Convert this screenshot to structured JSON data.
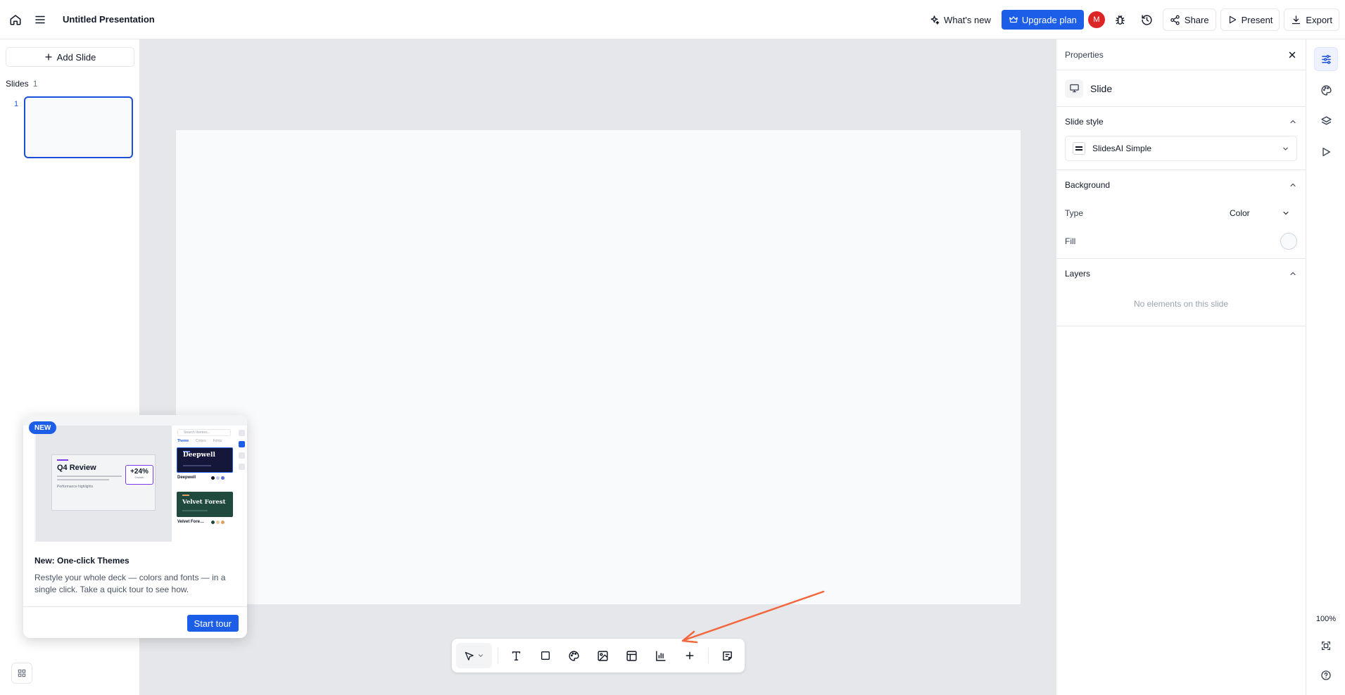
{
  "topbar": {
    "title": "Untitled Presentation",
    "whats_new": "What's new",
    "upgrade": "Upgrade plan",
    "avatar_initial": "M",
    "share": "Share",
    "present": "Present",
    "export": "Export"
  },
  "sidebar": {
    "add_slide": "Add Slide",
    "slides_label": "Slides",
    "slides_count": "1",
    "thumbnails": [
      {
        "number": "1"
      }
    ]
  },
  "properties": {
    "title": "Properties",
    "slide_label": "Slide",
    "slide_style": {
      "heading": "Slide style",
      "selected": "SlidesAI Simple"
    },
    "background": {
      "heading": "Background",
      "type_label": "Type",
      "type_value": "Color",
      "fill_label": "Fill"
    },
    "layers": {
      "heading": "Layers",
      "empty": "No elements on this slide"
    }
  },
  "rail": {
    "zoom": "100%"
  },
  "toolbar": {
    "tools": [
      "select-tool",
      "text-tool",
      "shape-tool",
      "palette-tool",
      "image-tool",
      "table-tool",
      "chart-tool",
      "add-tool",
      "notes-tool"
    ]
  },
  "popup": {
    "badge": "NEW",
    "title": "New: One-click Themes",
    "body": "Restyle your whole deck — colors and fonts — in a single click. Take a quick tour to see how.",
    "button": "Start tour",
    "preview": {
      "card_title": "Q4 Review",
      "card_subtitle": "Performance highlights",
      "stat_value": "+24%",
      "stat_label": "Growth",
      "search_placeholder": "Search themes...",
      "tabs": [
        "Theme",
        "Colors",
        "Fonts"
      ],
      "themes": [
        {
          "name": "Deepwell",
          "caption": "Deepwell",
          "color": "#15173a"
        },
        {
          "name": "Velvet Forest",
          "caption": "Velvet Fore…",
          "color": "#1f4a3d"
        }
      ]
    }
  },
  "colors": {
    "accent": "#1d5ee8",
    "avatar": "#dc2626",
    "annotation_arrow": "#f2673d"
  }
}
